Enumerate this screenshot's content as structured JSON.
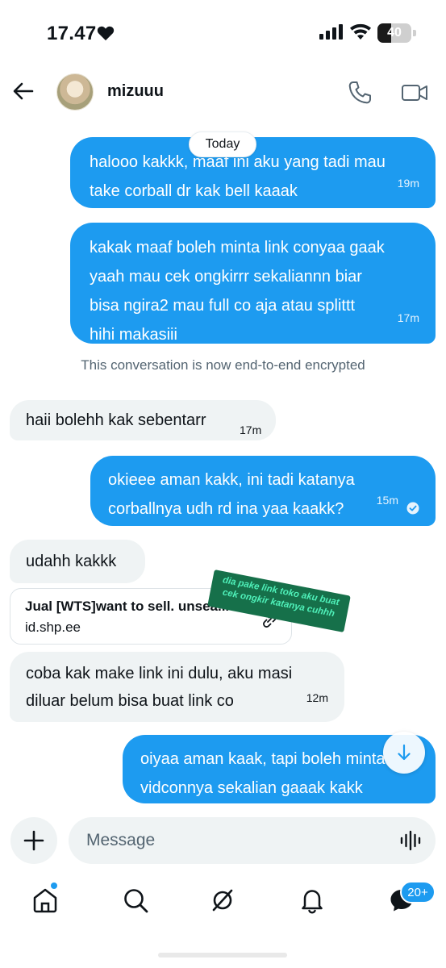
{
  "status_bar": {
    "time": "17.47",
    "battery_level": "40",
    "battery_fraction": 0.4,
    "icons": [
      "heart-icon",
      "signal-icon",
      "wifi-icon",
      "battery-icon"
    ]
  },
  "header": {
    "contact_name": "mizuuu",
    "icons": [
      "back-arrow-icon",
      "phone-icon",
      "video-call-icon"
    ]
  },
  "date_separator": "Today",
  "messages": [
    {
      "direction": "out",
      "lines": [
        "halooo kakkk, maaf ini aku yang tadi mau",
        "take corball dr kak bell kaaak"
      ],
      "time": "19m"
    },
    {
      "direction": "out",
      "lines": [
        "kakak maaf boleh minta link conyaa gaak",
        "yaah mau cek ongkirrr sekaliannn biar",
        "bisa ngira2 mau full co aja atau splittt",
        "hihi makasiii"
      ],
      "time": "17m"
    },
    {
      "direction": "in",
      "lines": [
        "haii bolehh kak sebentarr"
      ],
      "time": "17m"
    },
    {
      "direction": "out",
      "lines": [
        "okieee aman kakk, ini tadi katanya",
        "corballnya udh rd ina yaa kaakk?"
      ],
      "time": "15m",
      "read": true
    },
    {
      "direction": "in",
      "lines": [
        "udahh kakkk"
      ]
    },
    {
      "direction": "in",
      "lines": [
        "coba kak make link ini dulu, aku masi",
        "diluar belum bisa buat link co"
      ],
      "time": "12m"
    },
    {
      "direction": "out",
      "lines": [
        "oiyaa aman kaak, tapi boleh minta",
        "vidconnya sekalian gaaak kakk"
      ]
    }
  ],
  "system_message": "This conversation is now end-to-end encrypted",
  "link_card": {
    "title": "Jual [WTS]want to sell. unsea...",
    "domain": "id.shp.ee"
  },
  "annotation": "dia pake link toko aku buat cek ongkir katanya cuhhh",
  "composer": {
    "placeholder": "Message",
    "icons": [
      "plus-icon",
      "voice-wave-icon"
    ]
  },
  "bottom_nav": {
    "items": [
      "home",
      "search",
      "grok",
      "notifications",
      "messages"
    ],
    "messages_badge": "20+"
  },
  "colors": {
    "accent": "#1d9bf0",
    "incoming_bubble": "#eff3f4",
    "annotation_bg": "#16704a",
    "annotation_text": "#4ff0b9"
  }
}
